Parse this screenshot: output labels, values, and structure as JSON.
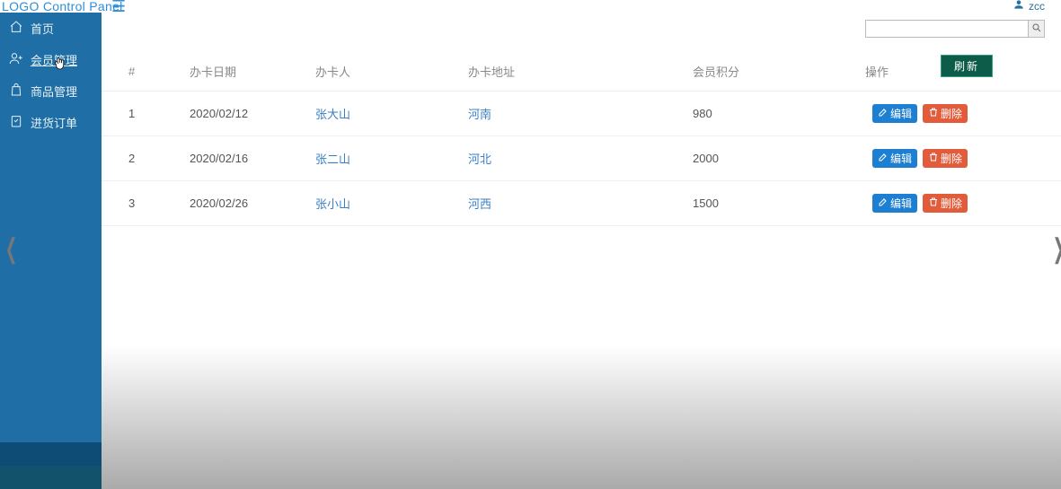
{
  "header": {
    "logo": "LOGO Control Panel",
    "username": "zcc"
  },
  "search": {
    "value": "",
    "placeholder": ""
  },
  "sidebar": {
    "items": [
      {
        "label": "首页"
      },
      {
        "label": "会员管理"
      },
      {
        "label": "商品管理"
      },
      {
        "label": "进货订单"
      }
    ]
  },
  "actions": {
    "refresh": "刷新",
    "edit": "编辑",
    "delete": "删除"
  },
  "table": {
    "headers": {
      "index": "#",
      "date": "办卡日期",
      "person": "办卡人",
      "address": "办卡地址",
      "points": "会员积分",
      "ops": "操作"
    },
    "rows": [
      {
        "index": "1",
        "date": "2020/02/12",
        "person": "张大山",
        "address": "河南",
        "points": "980"
      },
      {
        "index": "2",
        "date": "2020/02/16",
        "person": "张二山",
        "address": "河北",
        "points": "2000"
      },
      {
        "index": "3",
        "date": "2020/02/26",
        "person": "张小山",
        "address": "河西",
        "points": "1500"
      }
    ]
  }
}
